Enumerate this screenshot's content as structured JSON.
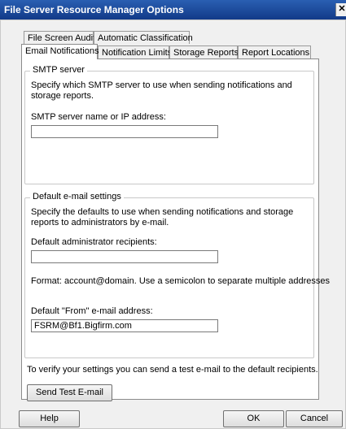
{
  "window": {
    "title": "File Server Resource Manager Options",
    "close_glyph": "✕"
  },
  "tabs_row1": [
    "File Screen Audit",
    "Automatic Classification"
  ],
  "tabs_row2": [
    "Email Notifications",
    "Notification Limits",
    "Storage Reports",
    "Report Locations"
  ],
  "active_tab": "Email Notifications",
  "smtp": {
    "legend": "SMTP server",
    "description": "Specify which SMTP server to use when sending notifications and storage reports.",
    "server_label": "SMTP server name or IP address:",
    "server_value": ""
  },
  "email_defaults": {
    "legend": "Default e-mail settings",
    "description": "Specify the defaults to use when sending notifications and storage reports to administrators by e-mail.",
    "recipients_label": "Default administrator recipients:",
    "recipients_value": "",
    "format_hint": "Format: account@domain. Use a semicolon to separate multiple addresses",
    "from_label": "Default \"From\" e-mail address:",
    "from_value": "FSRM@Bf1.Bigfirm.com"
  },
  "test": {
    "description": "To verify your settings you can send a test e-mail to the default recipients.",
    "button_label": "Send Test E-mail"
  },
  "footer": {
    "help_label": "Help",
    "ok_label": "OK",
    "cancel_label": "Cancel"
  },
  "colors": {
    "titlebar": "#1f4e9d",
    "panel": "#ffffff",
    "dialog": "#f0f0f0"
  }
}
